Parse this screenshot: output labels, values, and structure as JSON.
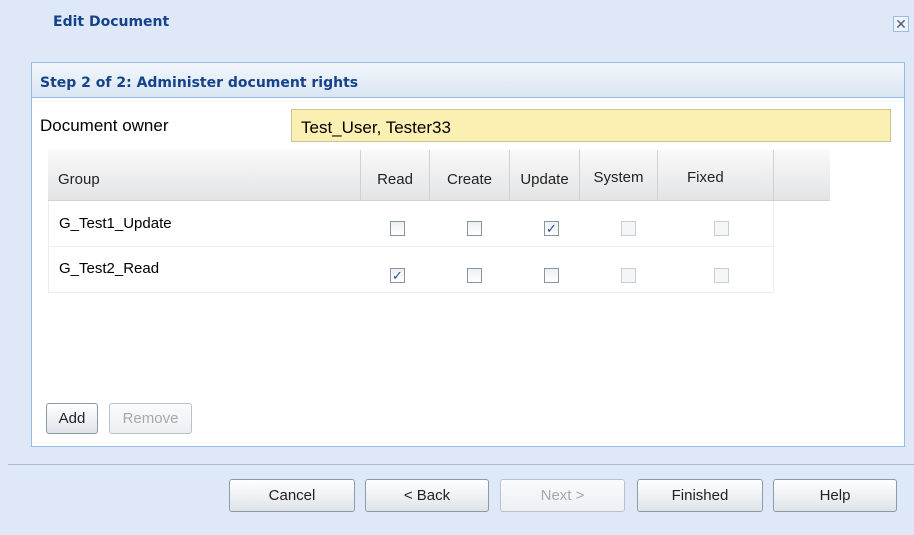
{
  "dialog": {
    "title": "Edit Document",
    "close_glyph": "✕"
  },
  "panel": {
    "title": "Step 2 of 2: Administer document rights"
  },
  "owner": {
    "label": "Document owner",
    "value": "Test_User, Tester33"
  },
  "grid": {
    "columns": [
      "Group",
      "Read",
      "Create",
      "Update",
      "System",
      "Fixed"
    ],
    "rows": [
      {
        "group": "G_Test1_Update",
        "read": false,
        "create": false,
        "update": true,
        "system": false,
        "fixed": false
      },
      {
        "group": "G_Test2_Read",
        "read": true,
        "create": false,
        "update": false,
        "system": false,
        "fixed": false
      }
    ]
  },
  "panel_buttons": {
    "add": "Add",
    "remove": "Remove"
  },
  "footer_buttons": {
    "cancel": "Cancel",
    "back": "< Back",
    "next": "Next >",
    "finished": "Finished",
    "help": "Help"
  },
  "check_glyph": "✓"
}
